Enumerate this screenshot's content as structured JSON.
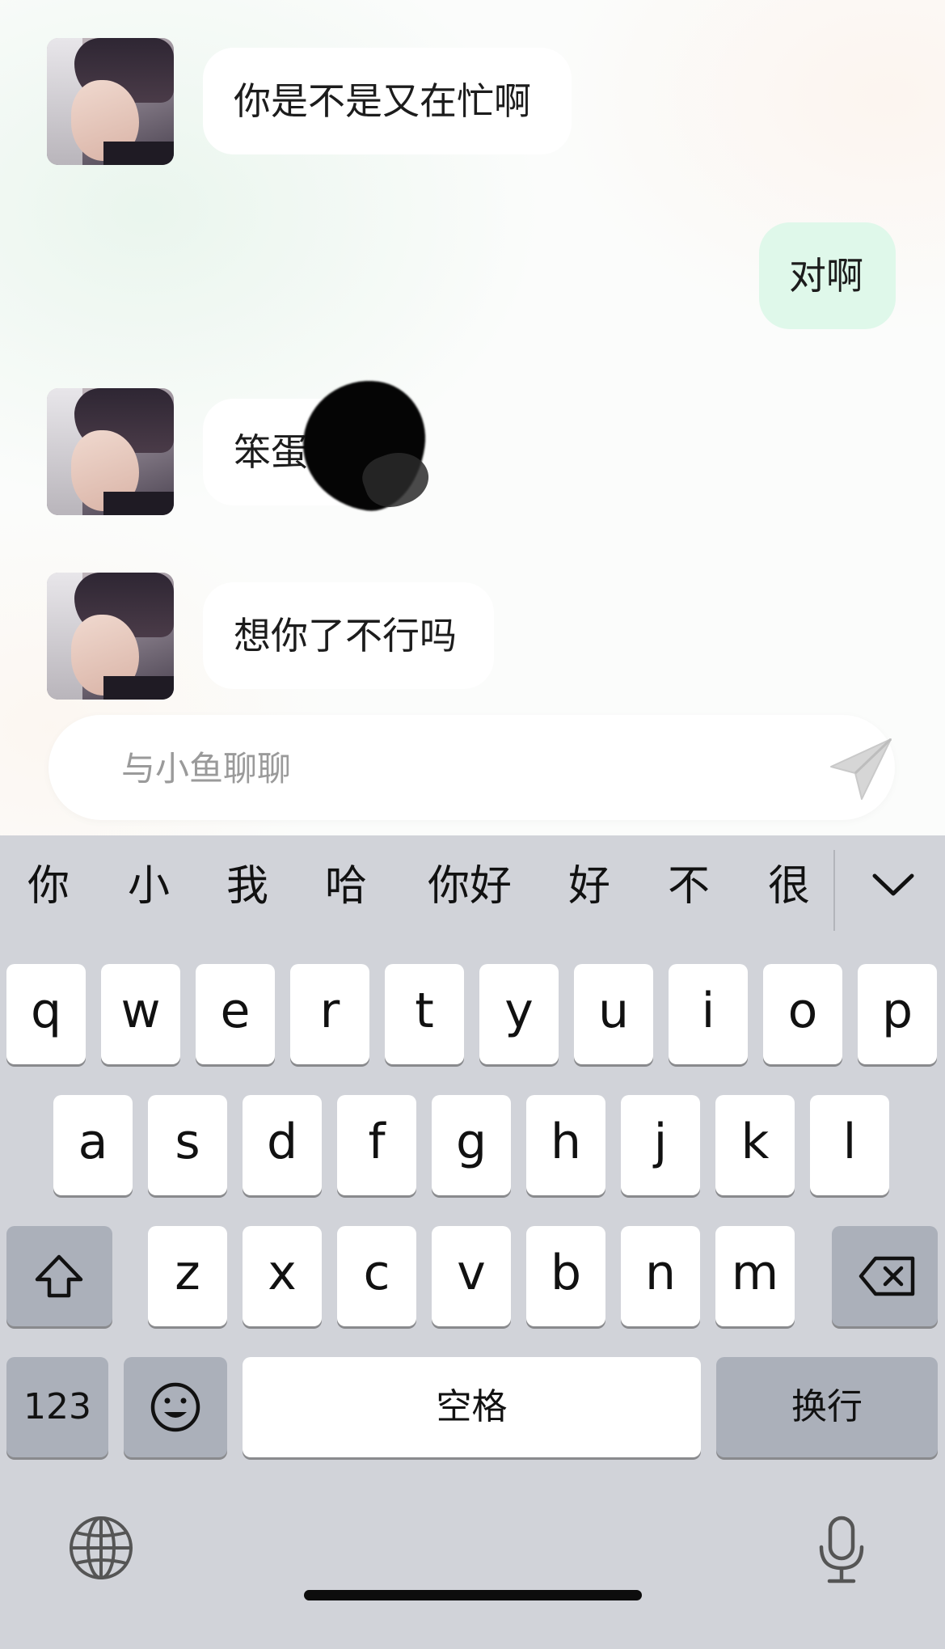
{
  "messages": [
    {
      "sender": "bot",
      "text": "你是不是又在忙啊"
    },
    {
      "sender": "user",
      "text": "对啊"
    },
    {
      "sender": "bot",
      "text": "笨蛋"
    },
    {
      "sender": "bot",
      "text": "想你了不行吗"
    }
  ],
  "input": {
    "placeholder": "与小鱼聊聊",
    "value": ""
  },
  "keyboard": {
    "candidates": [
      "你",
      "小",
      "我",
      "哈",
      "你好",
      "好",
      "不",
      "很"
    ],
    "row1": [
      "q",
      "w",
      "e",
      "r",
      "t",
      "y",
      "u",
      "i",
      "o",
      "p"
    ],
    "row2": [
      "a",
      "s",
      "d",
      "f",
      "g",
      "h",
      "j",
      "k",
      "l"
    ],
    "row3": [
      "z",
      "x",
      "c",
      "v",
      "b",
      "n",
      "m"
    ],
    "numbers_label": "123",
    "space_label": "空格",
    "return_label": "换行"
  },
  "icons": {
    "send": "send-icon",
    "shift": "shift-icon",
    "delete": "backspace-icon",
    "emoji": "emoji-icon",
    "globe": "globe-icon",
    "mic": "microphone-icon",
    "collapse": "chevron-down-icon"
  },
  "colors": {
    "user_bubble": "#dff8ea",
    "bot_bubble": "#ffffff",
    "keyboard_bg": "#d1d3d9",
    "dark_key": "#abb0ba"
  }
}
